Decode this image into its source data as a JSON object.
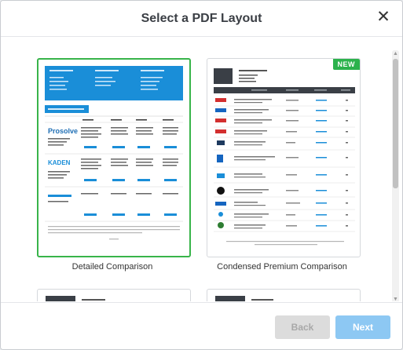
{
  "dialog": {
    "title": "Select a PDF Layout",
    "close_glyph": "✕"
  },
  "layouts": [
    {
      "label": "Detailed Comparison",
      "selected": true
    },
    {
      "label": "Condensed Premium Comparison",
      "selected": false,
      "badge": "NEW"
    }
  ],
  "footer": {
    "back_label": "Back",
    "next_label": "Next"
  },
  "colors": {
    "accent_green": "#38b44a",
    "badge_green": "#2bb24c",
    "header_blue": "#1a8ed8",
    "next_button": "#8dc8f3",
    "back_button": "#dcdcdc",
    "dark_header": "#3a3f46"
  }
}
